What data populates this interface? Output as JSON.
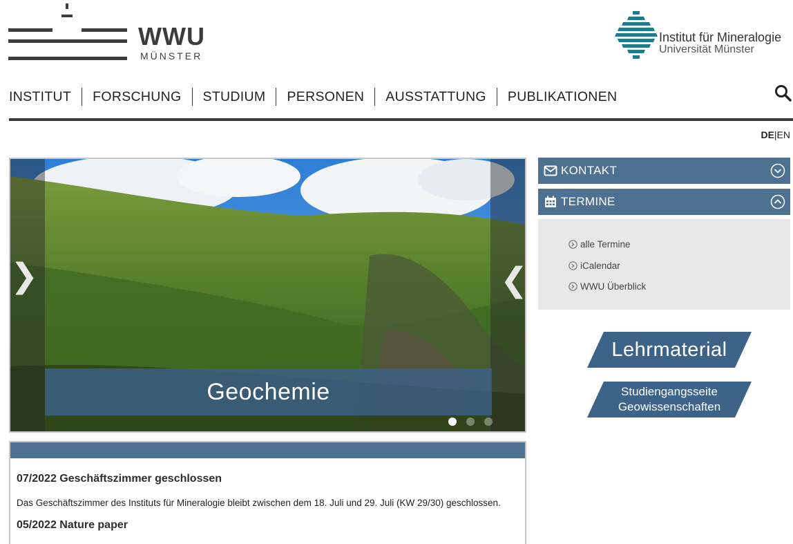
{
  "header": {
    "wwu_name": "WWU",
    "wwu_sub": "MÜNSTER",
    "institute_line1": "Institut für Mineralogie",
    "institute_line2": "Universität Münster"
  },
  "nav": {
    "items": [
      {
        "label": "INSTITUT"
      },
      {
        "label": "FORSCHUNG"
      },
      {
        "label": "STUDIUM"
      },
      {
        "label": "PERSONEN"
      },
      {
        "label": "AUSSTATTUNG"
      },
      {
        "label": "PUBLIKATIONEN"
      }
    ],
    "search_icon": "search-icon"
  },
  "language": {
    "active": "DE",
    "separator": "|",
    "other": "EN"
  },
  "slider": {
    "caption": "Geochemie",
    "prev_arrow": "❯",
    "next_arrow": "❮",
    "slide_count": 3,
    "active_slide": 1
  },
  "news": {
    "items": [
      {
        "title": "07/2022 Geschäftszimmer geschlossen",
        "text": "Das Geschäftszimmer des Instituts für Mineralogie bleibt zwischen dem 18. Juli und 29. Juli (KW 29/30) geschlossen."
      },
      {
        "title": "05/2022 Nature paper"
      }
    ]
  },
  "sidebar": {
    "kontakt": {
      "label": "KONTAKT",
      "icon": "envelope-icon",
      "state": "collapsed"
    },
    "termine": {
      "label": "TERMINE",
      "icon": "calendar-icon",
      "state": "expanded",
      "links": [
        {
          "label": "alle Termine"
        },
        {
          "label": "iCalendar"
        },
        {
          "label": "WWU Überblick"
        }
      ]
    },
    "buttons": {
      "lehrmaterial": "Lehrmaterial",
      "studiengang_line1": "Studiengangsseite",
      "studiengang_line2": "Geowissenschaften"
    }
  },
  "colors": {
    "accent": "#4e7091",
    "nav_rule": "#3c3a36",
    "panel_bg": "#e8e8e8",
    "button": "#3d6488"
  }
}
